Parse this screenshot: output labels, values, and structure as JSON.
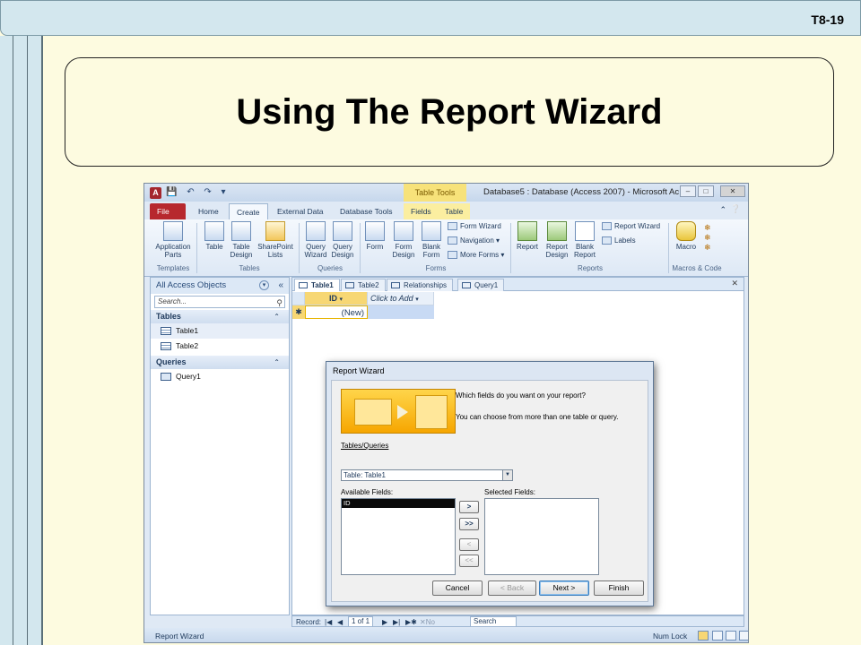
{
  "slide": {
    "number": "T8-19",
    "title": "Using The Report Wizard"
  },
  "window": {
    "title": "Database5 : Database (Access 2007)  -  Microsoft Ac...",
    "contextual_tab": "Table Tools",
    "app_icon": "A"
  },
  "ribbon_tabs": [
    "File",
    "Home",
    "Create",
    "External Data",
    "Database Tools",
    "Fields",
    "Table"
  ],
  "ribbon": {
    "application_parts": "Application Parts",
    "table": "Table",
    "table_design": "Table Design",
    "sharepoint_lists": "SharePoint Lists",
    "query_wizard": "Query Wizard",
    "query_design": "Query Design",
    "form": "Form",
    "form_design": "Form Design",
    "blank_form": "Blank Form",
    "form_wizard": "Form Wizard",
    "navigation": "Navigation",
    "more_forms": "More Forms",
    "report": "Report",
    "report_design": "Report Design",
    "blank_report": "Blank Report",
    "report_wizard": "Report Wizard",
    "labels": "Labels",
    "macro": "Macro",
    "groups": [
      "Templates",
      "Tables",
      "Queries",
      "Forms",
      "Reports",
      "Macros & Code"
    ]
  },
  "nav_pane": {
    "header": "All Access Objects",
    "search_placeholder": "Search...",
    "tables_header": "Tables",
    "tables": [
      "Table1",
      "Table2"
    ],
    "queries_header": "Queries",
    "queries": [
      "Query1"
    ]
  },
  "doc_tabs": [
    "Table1",
    "Table2",
    "Relationships",
    "Query1"
  ],
  "datasheet": {
    "col_id": "ID",
    "col_add": "Click to Add",
    "new_row": "(New)"
  },
  "wizard": {
    "title": "Report Wizard",
    "question": "Which fields do you want on your report?",
    "hint": "You can choose from more than one table or query.",
    "tables_label": "Tables/Queries",
    "table_value": "Table: Table1",
    "available_label": "Available Fields:",
    "selected_label": "Selected Fields:",
    "available_fields": [
      "ID"
    ],
    "move_one": ">",
    "move_all": ">>",
    "remove_one": "<",
    "remove_all": "<<",
    "cancel": "Cancel",
    "back": "< Back",
    "next": "Next >",
    "finish": "Finish"
  },
  "record_nav": {
    "label": "Record:",
    "position": "1 of 1",
    "filter": "No Filter",
    "search": "Search"
  },
  "status_bar": {
    "left": "Report Wizard",
    "num_lock": "Num Lock"
  },
  "colors": {
    "slide_bg": "#fdfbe0",
    "slide_stripe": "#d3e7ee",
    "file_tab": "#b7282e",
    "wizard_graphic": "#f6a600"
  }
}
